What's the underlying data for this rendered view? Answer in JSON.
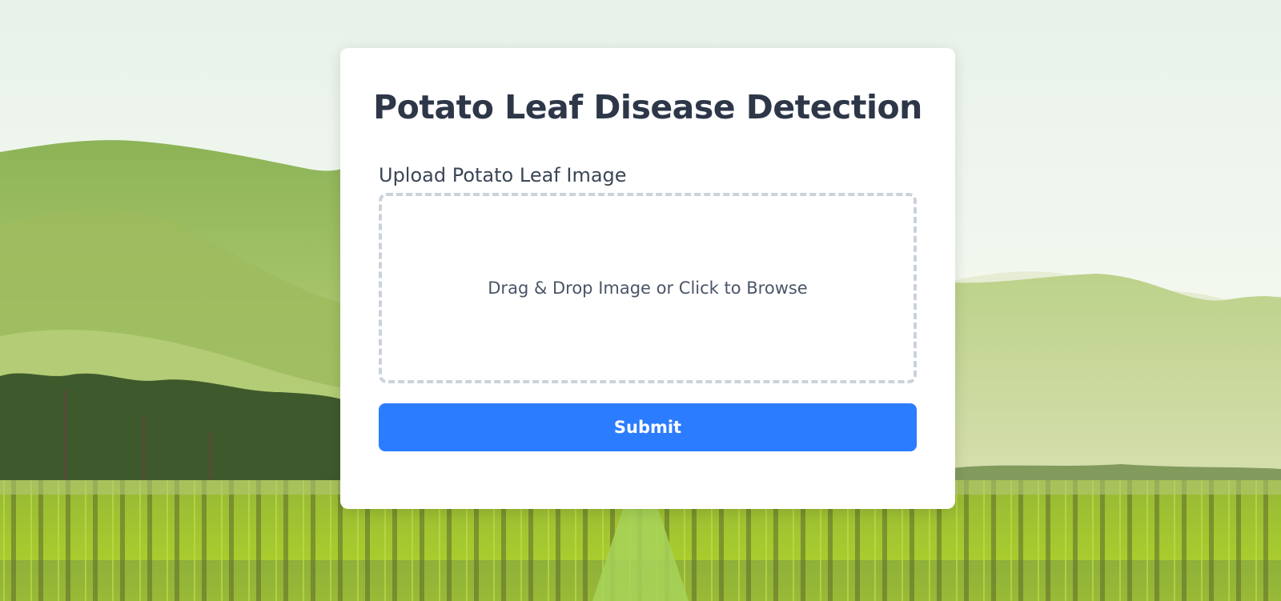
{
  "page": {
    "title": "Potato Leaf Disease Detection"
  },
  "form": {
    "upload_label": "Upload Potato Leaf Image",
    "dropzone_text": "Drag & Drop Image or Click to Browse",
    "submit_label": "Submit"
  },
  "colors": {
    "accent": "#2b7cff",
    "title_text": "#2d3748",
    "dropzone_border": "#cbd2da",
    "card_bg": "#ffffff"
  },
  "background": {
    "description_icon": "landscape-hills-vineyard-image"
  }
}
